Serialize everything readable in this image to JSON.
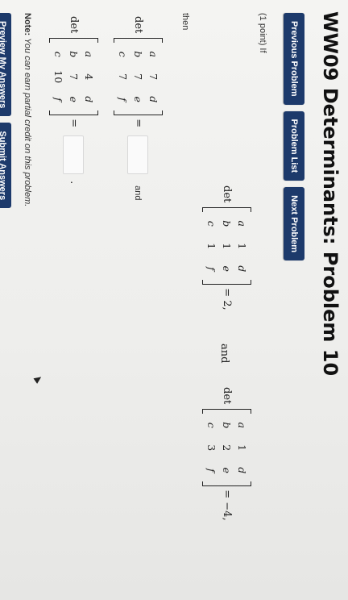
{
  "title": "WW09 Determinants: Problem 10",
  "nav": {
    "previous": "Previous Problem",
    "list": "Problem List",
    "next": "Next Problem"
  },
  "problem": {
    "points": "(1 point) If",
    "det_label": "det",
    "given1": {
      "rows": [
        [
          "a",
          "1",
          "d"
        ],
        [
          "b",
          "1",
          "e"
        ],
        [
          "c",
          "1",
          "f"
        ]
      ],
      "equals": "= 2,"
    },
    "and_word": "and",
    "given2": {
      "rows": [
        [
          "a",
          "1",
          "d"
        ],
        [
          "b",
          "2",
          "e"
        ],
        [
          "c",
          "3",
          "f"
        ]
      ],
      "equals": "= −4,"
    },
    "then": "then",
    "ask1": {
      "rows": [
        [
          "a",
          "7",
          "d"
        ],
        [
          "b",
          "7",
          "e"
        ],
        [
          "c",
          "7",
          "f"
        ]
      ],
      "equals": "=",
      "answer": "",
      "trailing": "and"
    },
    "ask2": {
      "rows": [
        [
          "a",
          "4",
          "d"
        ],
        [
          "b",
          "7",
          "e"
        ],
        [
          "c",
          "10",
          "f"
        ]
      ],
      "equals": "=",
      "answer": "",
      "trailing": "."
    }
  },
  "note": {
    "label": "Note:",
    "text": "You can earn partial credit on this problem."
  },
  "buttons": {
    "preview": "Preview My Answers",
    "submit": "Submit Answers"
  }
}
